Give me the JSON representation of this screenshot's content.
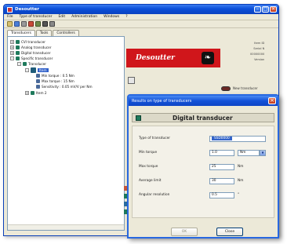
{
  "main_window": {
    "title": "Desoutter",
    "menu": [
      "File",
      "Type of transducer",
      "Edit",
      "Administration",
      "Windows",
      "?"
    ],
    "tabs": [
      "Transducers",
      "Tools",
      "Controllers"
    ],
    "tree": [
      {
        "label": "CVI transducer",
        "level": 0,
        "expander": "+"
      },
      {
        "label": "Analog transducer",
        "level": 0,
        "expander": "+"
      },
      {
        "label": "Digital transducer",
        "level": 0,
        "expander": "+"
      },
      {
        "label": "Specific transducer",
        "level": 0,
        "expander": "-"
      },
      {
        "label": "Transducer",
        "level": 1,
        "expander": "-"
      },
      {
        "label": "Item",
        "level": 2,
        "expander": "-",
        "selected": true
      },
      {
        "label": "Min torque : 0.5 Nm",
        "level": 3
      },
      {
        "label": "Max torque : 15 Nm",
        "level": 3
      },
      {
        "label": "Sensitivity : 0.05 mV/V per Nm",
        "level": 3
      },
      {
        "label": "Item 2",
        "level": 2,
        "expander": "+"
      }
    ],
    "logo_text": "Desoutter",
    "info": [
      "Item ID",
      "Serial N",
      "00000000",
      "Version"
    ],
    "state_text": "New transducer"
  },
  "dialog": {
    "title": "Results on type of transducers",
    "heading": "Digital transducer",
    "fields": [
      {
        "label": "Type of transducer",
        "value": "SSD0000",
        "unit": ""
      },
      {
        "label": "Min torque",
        "value": "1.0",
        "unit": "Nm"
      },
      {
        "label": "Max torque",
        "value": "25",
        "unit": "Nm"
      },
      {
        "label": "Average limit",
        "value": "30",
        "unit": "Nm"
      },
      {
        "label": "Angular resolution",
        "value": "0.5",
        "unit": "°"
      }
    ],
    "ok_label": "OK",
    "close_label": "Close"
  },
  "colors": {
    "title_blue": "#0b4fd8",
    "brand_red": "#d0161b",
    "selection_blue": "#3565c9",
    "tree_icon_green": "#1f7a5c"
  }
}
